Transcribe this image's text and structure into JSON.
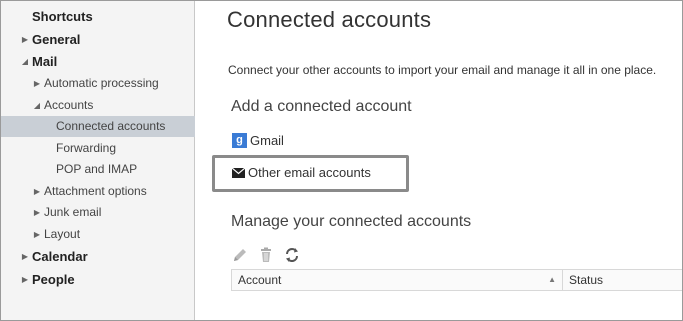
{
  "sidebar": {
    "shortcuts": "Shortcuts",
    "general": "General",
    "mail": "Mail",
    "automatic_processing": "Automatic processing",
    "accounts": "Accounts",
    "connected_accounts": "Connected accounts",
    "forwarding": "Forwarding",
    "pop_imap": "POP and IMAP",
    "attachment_options": "Attachment options",
    "junk_email": "Junk email",
    "layout": "Layout",
    "calendar": "Calendar",
    "people": "People"
  },
  "main": {
    "title": "Connected accounts",
    "intro": "Connect your other accounts to import your email and manage it all in one place.",
    "add_title": "Add a connected account",
    "gmail_label": "Gmail",
    "gmail_icon_letter": "g",
    "other_label": "Other email accounts",
    "manage_title": "Manage your connected accounts",
    "table": {
      "columns": [
        "Account",
        "Status"
      ]
    }
  },
  "icons": {
    "collapsed": "triangle-right",
    "expanded": "triangle-down-left",
    "edit": "pencil-icon",
    "delete": "trash-icon",
    "refresh": "refresh-icon",
    "gmail": "gmail-icon",
    "mail": "envelope-icon"
  },
  "colors": {
    "selected_bg": "#c9cfd6",
    "gmail_blue": "#3a7bd5",
    "highlight_border": "#8a8a8a"
  }
}
